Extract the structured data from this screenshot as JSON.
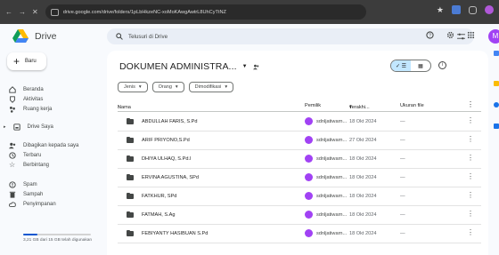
{
  "browser": {
    "url": "drive.google.com/drive/folders/1pLbHkzeNC-xoMoKAwgAwtrL8UhCyTtNZ",
    "nav_icons": [
      "back-icon",
      "forward-icon",
      "close-icon"
    ]
  },
  "app": {
    "name": "Drive",
    "search_placeholder": "Telusuri di Drive",
    "avatar_letter": "M",
    "accent": "#0b57d0",
    "avatar_color": "#a142f4"
  },
  "sidebar": {
    "new_label": "Baru",
    "items": [
      {
        "label": "Beranda",
        "icon": "home-icon"
      },
      {
        "label": "Aktivitas",
        "icon": "activity-icon"
      },
      {
        "label": "Ruang kerja",
        "icon": "workspace-icon"
      },
      {
        "label": "Drive Saya",
        "icon": "my-drive-icon"
      },
      {
        "label": "Dibagikan kepada saya",
        "icon": "shared-icon"
      },
      {
        "label": "Terbaru",
        "icon": "recent-icon"
      },
      {
        "label": "Berbintang",
        "icon": "star-icon"
      },
      {
        "label": "Spam",
        "icon": "spam-icon"
      },
      {
        "label": "Sampah",
        "icon": "trash-icon"
      },
      {
        "label": "Penyimpanan",
        "icon": "cloud-icon"
      }
    ],
    "storage_text": "3,21 GB dari 15 GB telah digunakan",
    "storage_used_fraction": 0.214
  },
  "main": {
    "folder_title": "DOKUMEN ADMINISTRA...",
    "chips": [
      {
        "label": "Jenis"
      },
      {
        "label": "Orang"
      },
      {
        "label": "Dimodifikasi"
      }
    ],
    "columns": {
      "name": "Nama",
      "owner": "Pemilik",
      "modified": "Terakhi...",
      "size": "Ukuran file"
    },
    "rows": [
      {
        "name": "ABDULLAH FARIS, S.Pd",
        "owner": "sdnljatiwarn...",
        "date": "18 Okt 2024",
        "size": "—"
      },
      {
        "name": "ARIF PRIYONO,S.Pd",
        "owner": "sdnljatiwarn...",
        "date": "27 Okt 2024",
        "size": "—"
      },
      {
        "name": "DHIYA ULHAQ, S.Pd.I",
        "owner": "sdnljatiwarn...",
        "date": "18 Okt 2024",
        "size": "—"
      },
      {
        "name": "ERVINA AGUSTINA, SPd",
        "owner": "sdnljatiwarn...",
        "date": "18 Okt 2024",
        "size": "—"
      },
      {
        "name": "FATKHUR, SPd",
        "owner": "sdnljatiwarn...",
        "date": "18 Okt 2024",
        "size": "—"
      },
      {
        "name": "FATMAH, S.Ag",
        "owner": "sdnljatiwarn...",
        "date": "18 Okt 2024",
        "size": "—"
      },
      {
        "name": "FEBIYANTY HASIBUAN S.Pd",
        "owner": "sdnljatiwarn...",
        "date": "18 Okt 2024",
        "size": "—"
      }
    ]
  }
}
